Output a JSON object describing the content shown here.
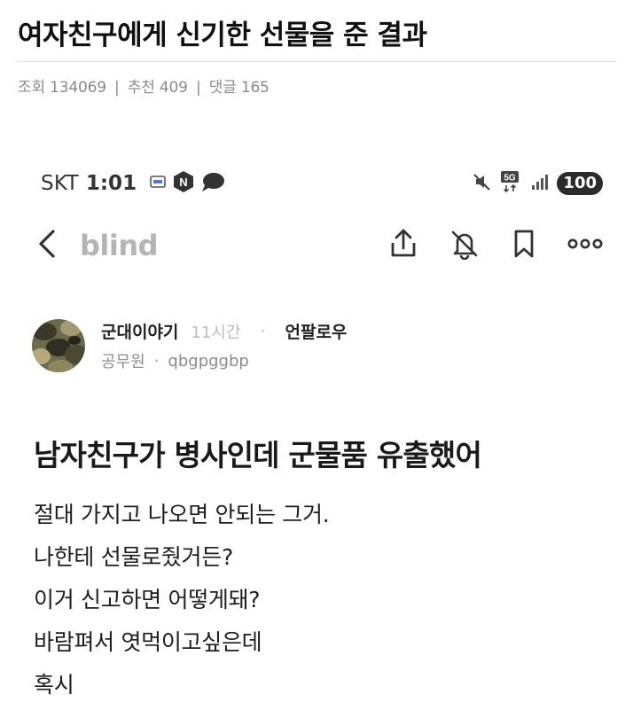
{
  "post": {
    "title": "여자친구에게 신기한 선물을 준 결과",
    "stats": {
      "views_label": "조회",
      "views": "134069",
      "recommend_label": "추천",
      "recommend": "409",
      "comments_label": "댓글",
      "comments": "165",
      "separator": "|"
    }
  },
  "screenshot": {
    "status_bar": {
      "carrier": "SKT",
      "time": "1:01",
      "network": "5G",
      "battery": "100",
      "icons": [
        "sd-icon",
        "n-app-icon",
        "chat-bubble-icon",
        "mute-icon",
        "5g-icon",
        "signal-icon"
      ]
    },
    "app_bar": {
      "brand": "blind",
      "icons": [
        "back-chevron-icon",
        "share-icon",
        "notification-off-icon",
        "bookmark-icon",
        "more-icon"
      ]
    },
    "author": {
      "name": "군대이야기",
      "time": "11시간",
      "dot": "·",
      "follow": "언팔로우",
      "job": "공무원",
      "id": "qbgpggbp"
    },
    "article": {
      "title": "남자친구가 병사인데 군물품 유출했어",
      "lines": [
        "절대 가지고 나오면 안되는 그거.",
        "나한테 선물로줬거든?",
        "이거 신고하면 어떻게돼?",
        "바람펴서 엿먹이고싶은데",
        "혹시"
      ]
    }
  }
}
